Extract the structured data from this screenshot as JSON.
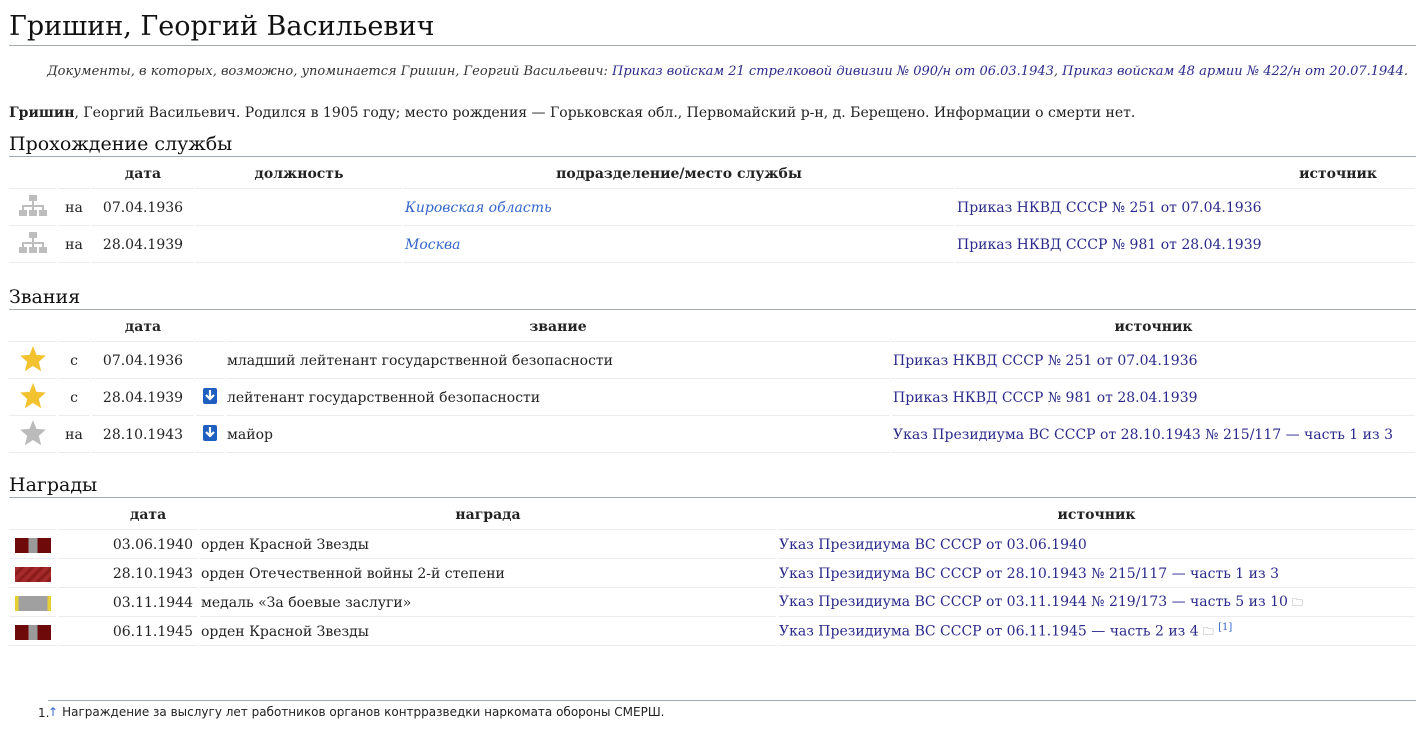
{
  "title": "Гришин, Георгий Васильевич",
  "docs": {
    "prefix": "Документы, в которых, возможно, упоминается Гришин, Георгий Васильевич:",
    "link1": "Приказ войскам 21 стрелковой дивизии № 090/н от 06.03.1943",
    "sep": ",",
    "link2": "Приказ войскам 48 армии № 422/н от 20.07.1944",
    "end": "."
  },
  "bio": {
    "surname": "Гришин",
    "rest": ", Георгий Васильевич. Родился в 1905 году; место рождения — Горьковская обл., Первомайский р-н, д. Берещено. Информации о смерти нет."
  },
  "service": {
    "heading": "Прохождение службы",
    "headers": [
      "дата",
      "должность",
      "подразделение/место службы",
      "источник"
    ],
    "rows": [
      {
        "prep": "на",
        "date": "07.04.1936",
        "position": "",
        "unit": "Кировская область",
        "source": "Приказ НКВД СССР № 251 от 07.04.1936"
      },
      {
        "prep": "на",
        "date": "28.04.1939",
        "position": "",
        "unit": "Москва",
        "source": "Приказ НКВД СССР № 981 от 28.04.1939"
      }
    ]
  },
  "ranks": {
    "heading": "Звания",
    "headers": [
      "дата",
      "звание",
      "источник"
    ],
    "rows": [
      {
        "prep": "с",
        "date": "07.04.1936",
        "rank": "младший лейтенант государственной безопасности",
        "source": "Приказ НКВД СССР № 251 от 07.04.1936",
        "star": "gold",
        "arrow": false
      },
      {
        "prep": "с",
        "date": "28.04.1939",
        "rank": "лейтенант государственной безопасности",
        "source": "Приказ НКВД СССР № 981 от 28.04.1939",
        "star": "gold",
        "arrow": true
      },
      {
        "prep": "на",
        "date": "28.10.1943",
        "rank": "майор",
        "source": "Указ Президиума ВС СССР от 28.10.1943 № 215/117 — часть 1 из 3",
        "star": "grey",
        "arrow": true
      }
    ]
  },
  "awards": {
    "heading": "Награды",
    "headers": [
      "дата",
      "награда",
      "источник"
    ],
    "rows": [
      {
        "date": "03.06.1940",
        "award": "орден Красной Звезды",
        "source": "Указ Президиума ВС СССР от 03.06.1940",
        "ribbon": "red-star",
        "folder": false,
        "note": ""
      },
      {
        "date": "28.10.1943",
        "award": "орден Отечественной войны 2-й степени",
        "source": "Указ Президиума ВС СССР от 28.10.1943 № 215/117 — часть 1 из 3",
        "ribbon": "patriotic-war",
        "folder": false,
        "note": ""
      },
      {
        "date": "03.11.1944",
        "award": "медаль «За боевые заслуги»",
        "source": "Указ Президиума ВС СССР от 03.11.1944 № 219/173 — часть 5 из 10",
        "ribbon": "combat-merit",
        "folder": true,
        "note": ""
      },
      {
        "date": "06.11.1945",
        "award": "орден Красной Звезды",
        "source": "Указ Президиума ВС СССР от 06.11.1945 — часть 2 из 4",
        "ribbon": "red-star",
        "folder": true,
        "note": "[1]"
      }
    ]
  },
  "footnotes": [
    {
      "num": "1.",
      "arrow": "↑",
      "text": "Награждение за выслугу лет работников органов контрразведки наркомата обороны СМЕРШ."
    }
  ],
  "icons": {
    "org_chart": "org-chart-icon",
    "star_gold": "#f2c230",
    "star_grey": "#bbbbbb",
    "arrow": "#1f5fbf"
  }
}
